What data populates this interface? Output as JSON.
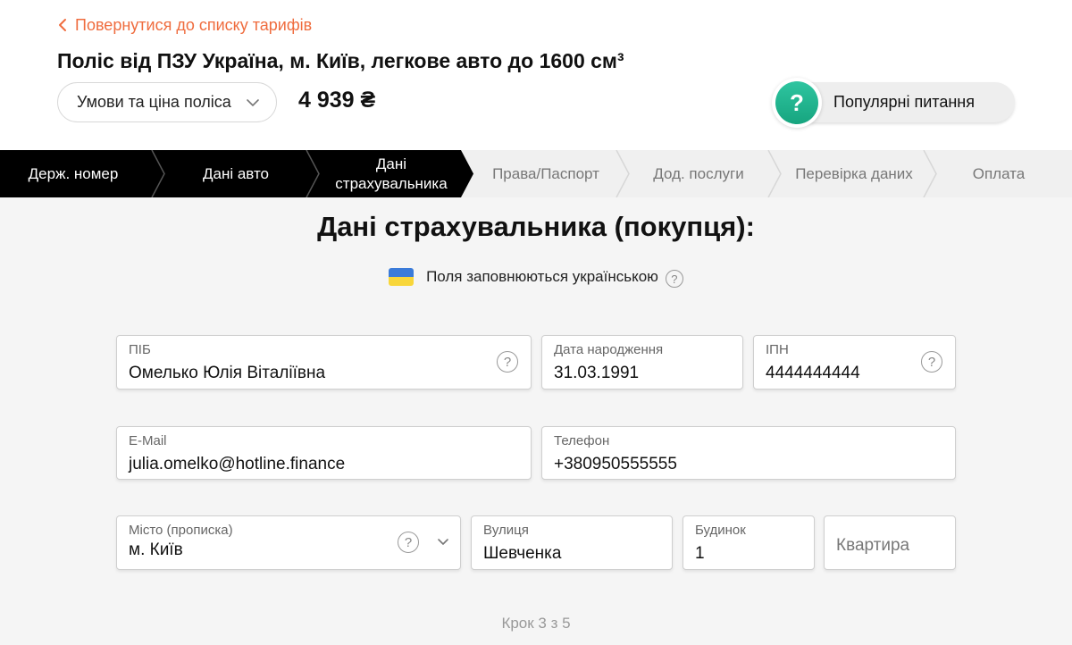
{
  "header": {
    "back_label": "Повернутися до списку тарифів",
    "policy_title": "Поліс від ПЗУ Україна, м. Київ, легкове авто до 1600 см³",
    "conditions_label": "Умови та ціна поліса",
    "price": "4 939 ₴",
    "faq_label": "Популярні питання",
    "faq_icon_glyph": "?"
  },
  "steps": [
    {
      "label": "Держ. номер",
      "state": "done"
    },
    {
      "label": "Дані авто",
      "state": "done"
    },
    {
      "label": "Дані страхувальника",
      "state": "current"
    },
    {
      "label": "Права/Паспорт",
      "state": "todo"
    },
    {
      "label": "Дод. послуги",
      "state": "todo"
    },
    {
      "label": "Перевірка даних",
      "state": "todo"
    },
    {
      "label": "Оплата",
      "state": "todo"
    }
  ],
  "form": {
    "title": "Дані страхувальника (покупця):",
    "language_note": "Поля заповнюються українською",
    "help_glyph": "?",
    "fields": {
      "full_name": {
        "label": "ПІБ",
        "value": "Омелько Юлія Віталіївна"
      },
      "birth_date": {
        "label": "Дата народження",
        "value": "31.03.1991"
      },
      "tax_id": {
        "label": "ІПН",
        "value": "4444444444"
      },
      "email": {
        "label": "E-Mail",
        "value": "julia.omelko@hotline.finance"
      },
      "phone": {
        "label": "Телефон",
        "value": "+380950555555"
      },
      "city": {
        "label": "Місто (прописка)",
        "value": "м. Київ"
      },
      "street": {
        "label": "Вулиця",
        "value": "Шевченка"
      },
      "house": {
        "label": "Будинок",
        "value": "1"
      },
      "apartment": {
        "placeholder": "Квартира"
      }
    }
  },
  "footer": {
    "step_counter": "Крок 3 з 5"
  },
  "colors": {
    "accent": "#ef6c3e",
    "stepper_done": "#000000",
    "stepper_todo": "#f0f0f0",
    "faq_green": "#1fb48c",
    "flag_blue": "#3b7bd9",
    "flag_yellow": "#f8d63a"
  },
  "icons": {
    "back": "chevron-left-icon",
    "conditions": "chevron-down-icon",
    "faq": "question-circle-icon",
    "flag": "ukraine-flag-icon",
    "help": "help-icon",
    "city_dropdown": "chevron-down-icon"
  }
}
